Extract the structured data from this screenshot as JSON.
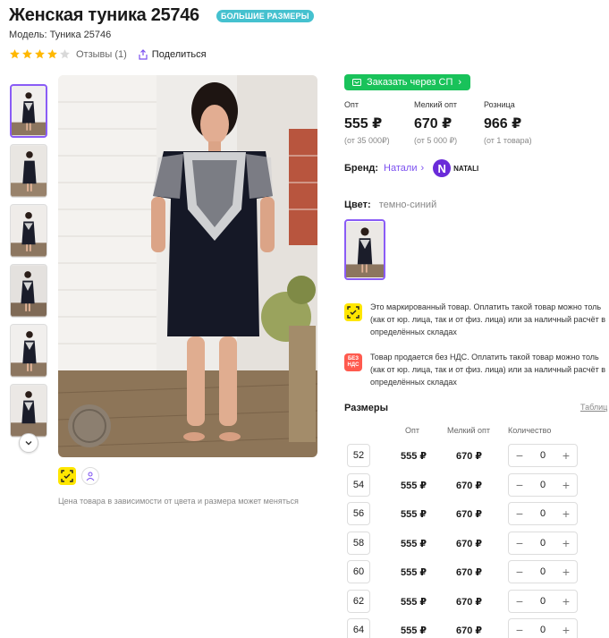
{
  "product": {
    "title": "Женская туника 25746",
    "badge": "БОЛЬШИЕ РАЗМЕРЫ",
    "model": "Модель: Туника 25746",
    "rating": 4,
    "reviews": "Отзывы (1)",
    "share": "Поделиться"
  },
  "gallery": {
    "price_note": "Цена товара в зависимости от цвета и размера может меняться"
  },
  "order_button": "Заказать через СП",
  "prices": [
    {
      "label": "Опт",
      "value": "555 ₽",
      "sub": "(от 35 000₽)"
    },
    {
      "label": "Мелкий опт",
      "value": "670 ₽",
      "sub": "(от 5 000 ₽)"
    },
    {
      "label": "Розница",
      "value": "966 ₽",
      "sub": "(от 1 товара)"
    }
  ],
  "brand": {
    "label": "Бренд:",
    "name": "Натали",
    "logo_letter": "N",
    "logo_text": "NATALI"
  },
  "color": {
    "label": "Цвет:",
    "value": "темно-синий"
  },
  "notices": [
    {
      "icon": "marking-icon",
      "lines": [
        "Это маркированный товар. Оплатить такой товар можно толь",
        "(как от юр. лица, так и от физ. лица) или за наличный расчёт в",
        "определённых складах"
      ]
    },
    {
      "icon": "no-vat-icon",
      "icon_text": [
        "БЕЗ",
        "НДС"
      ],
      "lines": [
        "Товар продается без НДС. Оплатить такой товар можно толь",
        "(как от юр. лица, так и от физ. лица) или за наличный расчёт в",
        "определённых складах"
      ]
    }
  ],
  "sizes": {
    "title": "Размеры",
    "table_link": "Таблиц",
    "headers": [
      "Опт",
      "Мелкий опт",
      "Количество"
    ],
    "rows": [
      {
        "size": "52",
        "opt": "555 ₽",
        "small": "670 ₽",
        "qty": "0"
      },
      {
        "size": "54",
        "opt": "555 ₽",
        "small": "670 ₽",
        "qty": "0"
      },
      {
        "size": "56",
        "opt": "555 ₽",
        "small": "670 ₽",
        "qty": "0"
      },
      {
        "size": "58",
        "opt": "555 ₽",
        "small": "670 ₽",
        "qty": "0"
      },
      {
        "size": "60",
        "opt": "555 ₽",
        "small": "670 ₽",
        "qty": "0"
      },
      {
        "size": "62",
        "opt": "555 ₽",
        "small": "670 ₽",
        "qty": "0"
      },
      {
        "size": "64",
        "opt": "555 ₽",
        "small": "670 ₽",
        "qty": "0"
      }
    ],
    "minus": "−",
    "plus": "+"
  },
  "colors": {
    "accent": "#8a5cf6",
    "order_green": "#19c25a",
    "badge_teal": "#45c1cf",
    "star_gold": "#ffb800",
    "marking_yellow": "#ffe600",
    "novat_red": "#ff5a4e"
  }
}
